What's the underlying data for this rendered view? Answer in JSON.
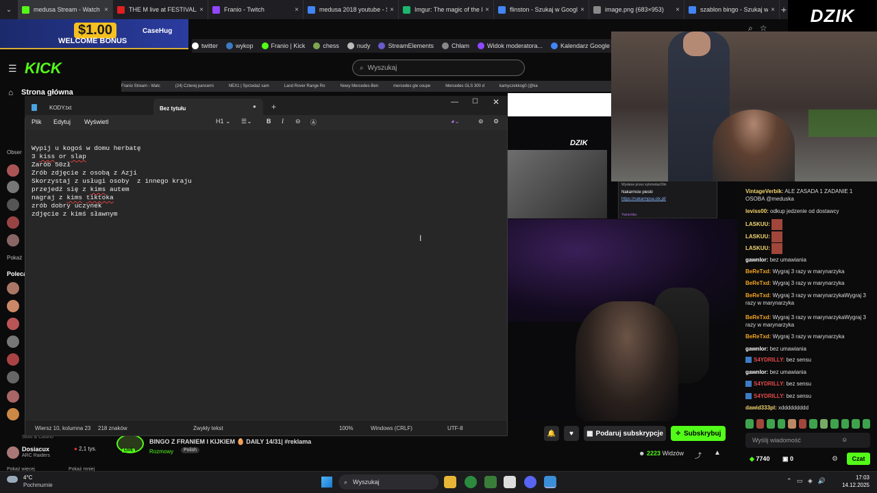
{
  "browser": {
    "tabs": [
      {
        "label": "medusa Stream - Watch",
        "color": "#53fc18",
        "active": true
      },
      {
        "label": "THE M live at FESTIVALAN",
        "color": "#e02020",
        "active": false
      },
      {
        "label": "Franio - Twitch",
        "color": "#9146ff",
        "active": false
      },
      {
        "label": "medusa 2018 youtube - S",
        "color": "#4285f4",
        "active": false
      },
      {
        "label": "Imgur: The magic of the I",
        "color": "#1bb76e",
        "active": false
      },
      {
        "label": "flinston - Szukaj w Googl",
        "color": "#4285f4",
        "active": false
      },
      {
        "label": "image.png (683×953)",
        "color": "#888888",
        "active": false
      },
      {
        "label": "szablon bingo - Szukaj w",
        "color": "#4285f4",
        "active": false
      }
    ],
    "new_tab": "+",
    "close_glyph": "×",
    "bookmarks": [
      {
        "label": "twitter",
        "color": "#ffffff"
      },
      {
        "label": "wykop",
        "color": "#3b7cc4"
      },
      {
        "label": "Franio | Kick",
        "color": "#53fc18"
      },
      {
        "label": "chess",
        "color": "#7fa650"
      },
      {
        "label": "nudy",
        "color": "#bbbbbb"
      },
      {
        "label": "StreamElements",
        "color": "#6a5acd"
      },
      {
        "label": "Chłam",
        "color": "#888888"
      },
      {
        "label": "Widok moderatora...",
        "color": "#9146ff"
      },
      {
        "label": "Kalendarz Google -...",
        "color": "#4285f4"
      }
    ]
  },
  "overlay": {
    "brand": "DZIK"
  },
  "ad": {
    "price": "$1.00",
    "bonus": "WELCOME BONUS",
    "brand": "CaseHug"
  },
  "kick": {
    "logo": "KICK",
    "search_placeholder": "Wyszukaj",
    "home_label": "Strona główna",
    "sidebar_labels": {
      "followed": "Obser",
      "show": "Pokaż",
      "recommended": "Polecan"
    },
    "dosiacux": {
      "name": "Dosiacux",
      "category": "ARC Raiders",
      "viewers": "2,1 tys.",
      "prev_category": "Slots & Casino"
    },
    "show_more": "Pokaż więcej",
    "show_less": "Pokaż mniej"
  },
  "inner_tabs": [
    "Franio Stream - Watc",
    "(24) Czterej pancerni",
    "NEX1 | Sprzedaż sam",
    "Land Rover Range Ro",
    "Nowy Mercedes-Ben",
    "mercedes gle coupe",
    "Mercedes GLS 300 d",
    "kamyczekkog0 (@ka"
  ],
  "mini": {
    "dzik": "DZIK",
    "chat_sent_by": "Wysłane przez xylometazOlin",
    "chat_msg": "Nakarmcie pieski",
    "chat_link": "https://nakarmpsa.olx.pl/",
    "chat_user": "Yamenike:"
  },
  "notepad": {
    "tab1": "KODY.txt",
    "tab2": "Bez tytułu",
    "tab2_dot": "●",
    "new_tab": "+",
    "minimize": "—",
    "maximize": "☐",
    "close": "✕",
    "menu": [
      "Plik",
      "Edytuj",
      "Wyświetl"
    ],
    "heading_select": "H1",
    "lines": [
      "Wypij u kogoś w domu herbatę",
      "3 kiss or slap",
      "Zarób 50zł",
      "Zrób zdjęcie z osobą z Azji",
      "Skorzystaj z usługi osoby  z innego kraju",
      "przejedź się z kims autem",
      "nagraj z kims tiktoka",
      "zrób dobry uczynek",
      "zdjęcie z kimś sławnym"
    ],
    "status": {
      "position": "Wiersz 10, kolumna 23",
      "chars": "218 znaków",
      "format": "Zwykły tekst",
      "zoom": "100%",
      "eol": "Windows (CRLF)",
      "encoding": "UTF-8"
    }
  },
  "chat": {
    "messages": [
      {
        "user": "VintageVerbik:",
        "color": "#f5d76e",
        "text": " ALE ZASADA 1 ZADANIE 1 OSOBA @meduska"
      },
      {
        "user": "leviss00:",
        "color": "#f5d76e",
        "text": " odkup jedzenie od dostawcy"
      },
      {
        "user": "LASKUU:",
        "color": "#f5d76e",
        "text": ""
      },
      {
        "user": "LASKUU:",
        "color": "#f5d76e",
        "text": ""
      },
      {
        "user": "LASKUU:",
        "color": "#f5d76e",
        "text": ""
      },
      {
        "user": "gawnlor:",
        "color": "#ffffff",
        "text": " bez umawiania"
      },
      {
        "user": "BeReTxd:",
        "color": "#f5a623",
        "text": " Wygraj 3 razy w marynarzyka"
      },
      {
        "user": "BeReTxd:",
        "color": "#f5a623",
        "text": " Wygraj 3 razy w marynarzyka"
      },
      {
        "user": "BeReTxd:",
        "color": "#f5a623",
        "text": " Wygraj 3 razy w marynarzykaWygraj 3 razy w marynarzyka"
      },
      {
        "user": "BeReTxd:",
        "color": "#f5a623",
        "text": " Wygraj 3 razy w marynarzykaWygraj 3 razy w marynarzyka"
      },
      {
        "user": "BeReTxd:",
        "color": "#f5a623",
        "text": " Wygraj 3 razy w marynarzyka"
      },
      {
        "user": "gawnlor:",
        "color": "#ffffff",
        "text": " bez umawiania"
      },
      {
        "user": "S4YDRILLY:",
        "color": "#e84a4a",
        "text": " bez sensu"
      },
      {
        "user": "gawnlor:",
        "color": "#ffffff",
        "text": " bez umawiania"
      },
      {
        "user": "S4YDRILLY:",
        "color": "#e84a4a",
        "text": " bez sensu"
      },
      {
        "user": "S4YDRILLY:",
        "color": "#e84a4a",
        "text": " bez sensu"
      },
      {
        "user": "dawid333pl:",
        "color": "#f5d76e",
        "text": " xddddddddd"
      }
    ],
    "input_placeholder": "Wyślij wiadomość",
    "points": "7740",
    "second_count": "0",
    "send": "Czat"
  },
  "stream": {
    "gift_label": "Podaruj subskrypcje",
    "subscribe_label": "Subskrybuj",
    "viewers": "2223",
    "viewers_label": "Widzów"
  },
  "recommended": {
    "title": "BINGO Z FRANIEM I KIJKIEM 🥚 DAILY 14/31| #reklama",
    "category": "Rozmowy",
    "tag": "Polish",
    "live": "LIVE"
  },
  "taskbar": {
    "temp": "4°C",
    "weather": "Pochmurnie",
    "search": "Wyszukaj",
    "time": "17:03",
    "date": "14.12.2025"
  },
  "colors": {
    "kick_green": "#53fc18",
    "accent_blue": "#4aa3e0"
  }
}
